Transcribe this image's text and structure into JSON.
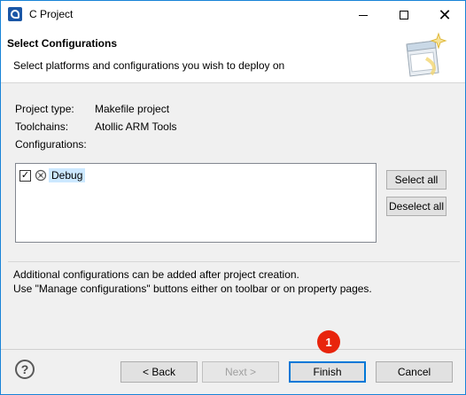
{
  "window": {
    "title": "C Project"
  },
  "banner": {
    "title": "Select Configurations",
    "subtitle": "Select platforms and configurations you wish to deploy on",
    "icon": "wizard-banner-icon"
  },
  "project": {
    "type_label": "Project type:",
    "type_value": "Makefile project",
    "toolchains_label": "Toolchains:",
    "toolchains_value": "Atollic ARM Tools",
    "configurations_label": "Configurations:"
  },
  "configurations": [
    {
      "label": "Debug",
      "checked": true,
      "icon": "config-gear-icon"
    }
  ],
  "side_buttons": {
    "select_all": "Select all",
    "deselect_all": "Deselect all"
  },
  "message": {
    "line1": "Additional configurations can be added after project creation.",
    "line2": "Use \"Manage configurations\" buttons either on toolbar or on property pages."
  },
  "footer": {
    "back": "< Back",
    "next": "Next >",
    "finish": "Finish",
    "cancel": "Cancel",
    "help": "?"
  },
  "annotation": {
    "step_badge": "1",
    "badge_color": "#e8240c"
  }
}
